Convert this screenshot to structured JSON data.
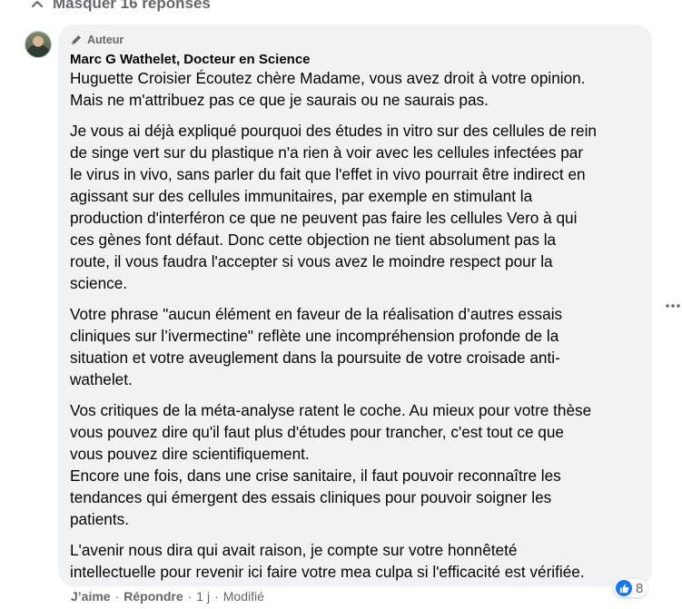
{
  "replies_toggle": {
    "label": "Masquer 16 réponses",
    "icon": "chevron-up-icon"
  },
  "comment": {
    "badge": "Auteur",
    "author": "Marc G Wathelet, Docteur en Science",
    "paragraphs": [
      "Huguette Croisier Écoutez chère Madame, vous avez droit à votre opinion.\nMais ne m'attribuez pas ce que je saurais ou ne saurais pas.",
      "Je vous ai déjà expliqué pourquoi des études in vitro sur des cellules de rein\nde singe vert sur du plastique n'a rien à voir avec les cellules infectées par\nle virus in vivo, sans parler du fait que l'effet in vivo pourrait être indirect en\nagissant sur des cellules immunitaires, par exemple en stimulant la\nproduction d'interféron ce que ne peuvent pas faire les cellules Vero à qui\nces gènes font défaut. Donc cette objection ne tient absolument pas la\nroute, il vous faudra l'accepter si vous avez le moindre respect pour la\nscience.",
      "Votre phrase \"aucun élément en faveur de la réalisation d’autres essais\ncliniques sur l’ivermectine\" reflète une incompréhension profonde de la\nsituation et votre aveuglement dans la poursuite de votre croisade anti-\nwathelet.",
      "Vos critiques de la méta-analyse ratent le coche. Au mieux pour votre thèse\nvous pouvez dire qu'il faut plus d'études pour trancher, c'est tout ce que\nvous pouvez dire scientifiquement.\nEncore une fois, dans une crise sanitaire, il faut pouvoir reconnaître les\ntendances qui émergent des essais cliniques pour pouvoir soigner les\npatients.",
      "L'avenir nous dira qui avait raison, je compte sur votre honnêteté\nintellectuelle pour revenir ici faire votre mea culpa si l'efficacité est vérifiée."
    ],
    "actions": {
      "like": "J’aime",
      "reply": "Répondre",
      "time": "1 j",
      "edited": "Modifié",
      "dot": "·"
    },
    "reaction_count": "8"
  },
  "colors": {
    "bubble": "#f0f2f5",
    "muted": "#65676b",
    "like_blue": "#1877f2"
  }
}
